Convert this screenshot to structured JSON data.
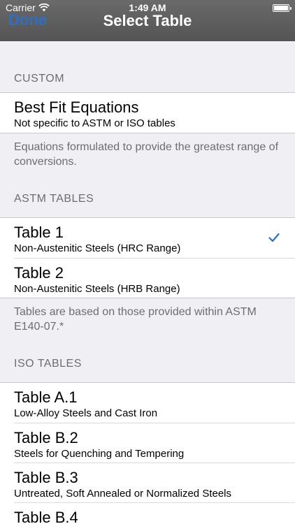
{
  "status_bar": {
    "carrier": "Carrier",
    "time": "1:49 AM",
    "wifi_icon": "wifi-icon",
    "battery_icon": "battery-icon",
    "battery_level": 1.0
  },
  "navbar": {
    "done_label": "Done",
    "title": "Select Table"
  },
  "colors": {
    "accent": "#2a6fc9",
    "navbar": "#5e5e5e",
    "background": "#efeff4",
    "secondary_text": "#6d6d72"
  },
  "sections": [
    {
      "header": "CUSTOM",
      "rows": [
        {
          "title": "Best Fit Equations",
          "subtitle": "Not specific to ASTM or ISO tables",
          "selected": false
        }
      ],
      "footer": "Equations formulated to provide the greatest range of conversions."
    },
    {
      "header": "ASTM TABLES",
      "rows": [
        {
          "title": "Table 1",
          "subtitle": "Non-Austenitic Steels (HRC Range)",
          "selected": true
        },
        {
          "title": "Table 2",
          "subtitle": "Non-Austenitic Steels (HRB Range)",
          "selected": false
        }
      ],
      "footer": "Tables are based on those provided within ASTM E140-07.*"
    },
    {
      "header": "ISO TABLES",
      "rows": [
        {
          "title": "Table A.1",
          "subtitle": "Low-Alloy Steels and Cast Iron",
          "selected": false
        },
        {
          "title": "Table B.2",
          "subtitle": "Steels for Quenching and Tempering",
          "selected": false
        },
        {
          "title": "Table B.3",
          "subtitle": "Untreated, Soft Annealed or Normalized Steels",
          "selected": false
        },
        {
          "title": "Table B.4",
          "subtitle": "",
          "selected": false
        }
      ]
    }
  ]
}
